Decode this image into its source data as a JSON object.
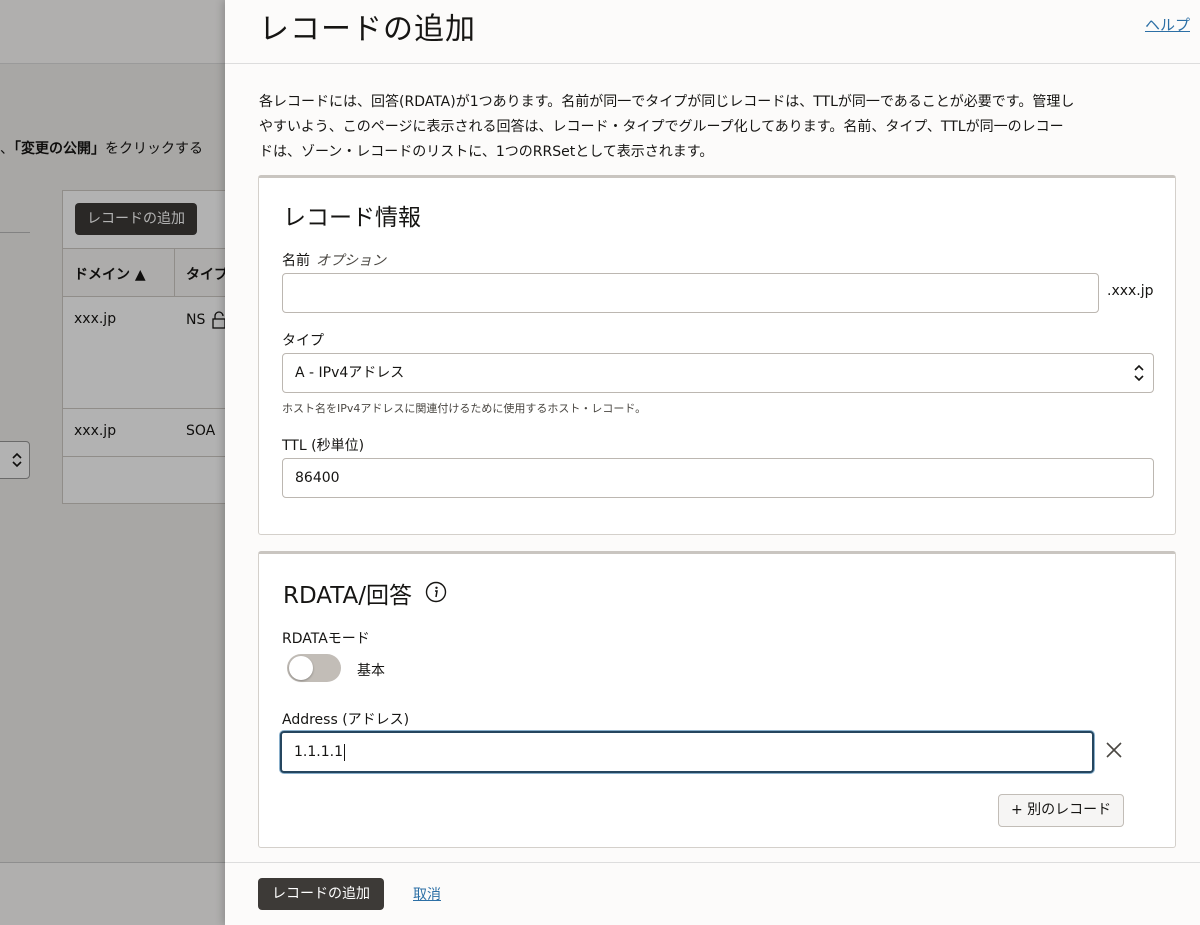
{
  "background": {
    "publish_text_prefix": "、",
    "publish_text_bold": "「変更の公開」",
    "publish_text_suffix": "をクリックする",
    "add_record_button": "レコードの追加",
    "table": {
      "col_domain": "ドメイン ▲",
      "col_type": "タイプ",
      "rows": [
        {
          "domain": "xxx.jp",
          "type": "NS"
        },
        {
          "domain": "xxx.jp",
          "type": "SOA"
        }
      ]
    }
  },
  "drawer": {
    "title": "レコードの追加",
    "help_link": "ヘルプ",
    "intro_lines": [
      "各レコードには、回答(RDATA)が1つあります。名前が同一でタイプが同じレコードは、TTLが同一であることが必要です。管理し",
      "やすいよう、このページに表示される回答は、レコード・タイプでグループ化してあります。名前、タイプ、TTLが同一のレコー",
      "ドは、ゾーン・レコードのリストに、1つのRRSetとして表示されます。"
    ],
    "record_info": {
      "heading": "レコード情報",
      "name_label": "名前",
      "name_optional": "オプション",
      "name_value": "",
      "name_suffix": ".xxx.jp",
      "type_label": "タイプ",
      "type_value": "A - IPv4アドレス",
      "type_hint": "ホスト名をIPv4アドレスに関連付けるために使用するホスト・レコード。",
      "ttl_label": "TTL (秒単位)",
      "ttl_value": "86400"
    },
    "rdata": {
      "heading": "RDATA/回答",
      "mode_label": "RDATAモード",
      "mode_toggle_on": false,
      "mode_value": "基本",
      "address_label": "Address (アドレス)",
      "address_value": "1.1.1.1",
      "another_record_button": "+ 別のレコード"
    },
    "footer": {
      "add_button": "レコードの追加",
      "cancel_link": "取消"
    }
  },
  "colors": {
    "primary_button": "#3d3a37",
    "link": "#2c6fa5",
    "focus_border": "#25465f",
    "overlay": "rgba(0,0,0,0.30)"
  }
}
